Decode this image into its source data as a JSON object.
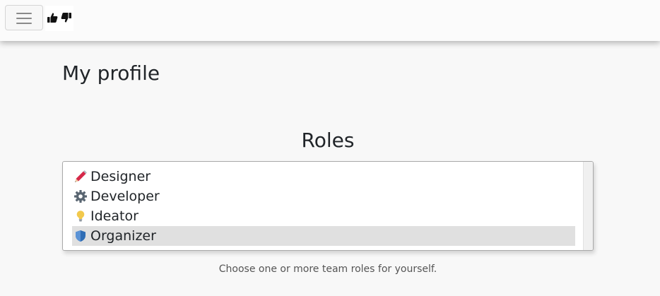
{
  "navbar": {
    "menu_toggle_icon": "hamburger-icon",
    "brand_icon": "thumbs-up-icon"
  },
  "page": {
    "title": "My profile"
  },
  "roles": {
    "heading": "Roles",
    "options": [
      {
        "label": "Designer",
        "icon": "pencil-icon",
        "selected": false
      },
      {
        "label": "Developer",
        "icon": "gear-icon",
        "selected": false
      },
      {
        "label": "Ideator",
        "icon": "lightbulb-icon",
        "selected": false
      },
      {
        "label": "Organizer",
        "icon": "shield-icon",
        "selected": true
      }
    ],
    "help_text": "Choose one or more team roles for yourself."
  },
  "colors": {
    "pencil": "#d6294a",
    "gear": "#5a6672",
    "lightbulb": "#f2c94c",
    "shield": "#2f6db5",
    "selected_row": "#e0e0e0"
  }
}
